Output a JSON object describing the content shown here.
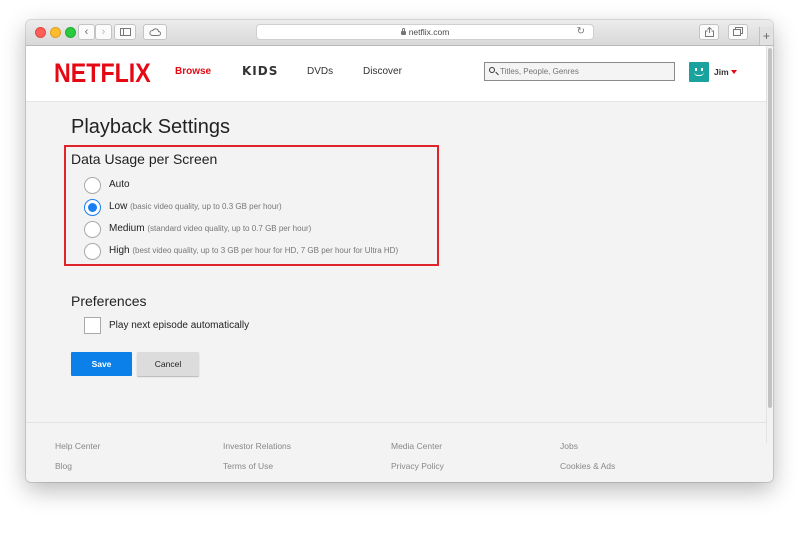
{
  "browser": {
    "url": "netflix.com",
    "reload_icon": "reload-icon",
    "plus_label": "+"
  },
  "header": {
    "logo": "NETFLIX",
    "nav": {
      "browse": "Browse",
      "kids": "KIDS",
      "dvds": "DVDs",
      "discover": "Discover"
    },
    "search_placeholder": "Titles, People, Genres",
    "user_name": "Jim"
  },
  "main": {
    "page_title": "Playback Settings",
    "data_usage": {
      "title": "Data Usage per Screen",
      "options": [
        {
          "label": "Auto",
          "desc": "",
          "selected": false
        },
        {
          "label": "Low",
          "desc": "(basic video quality, up to 0.3 GB per hour)",
          "selected": true
        },
        {
          "label": "Medium",
          "desc": "(standard video quality, up to 0.7 GB per hour)",
          "selected": false
        },
        {
          "label": "High",
          "desc": "(best video quality, up to 3 GB per hour for HD, 7 GB per hour for Ultra HD)",
          "selected": false
        }
      ]
    },
    "preferences": {
      "title": "Preferences",
      "autoplay_label": "Play next episode automatically",
      "autoplay_checked": false
    },
    "buttons": {
      "save": "Save",
      "cancel": "Cancel"
    }
  },
  "footer": {
    "links": [
      [
        "Help Center",
        "Blog"
      ],
      [
        "Investor Relations",
        "Terms of Use"
      ],
      [
        "Media Center",
        "Privacy Policy"
      ],
      [
        "Jobs",
        "Cookies & Ads"
      ]
    ]
  },
  "colors": {
    "brand_red": "#e50914",
    "radio_blue": "#1a7ff0",
    "save_blue": "#0b80e8",
    "highlight_red": "#e0242b",
    "avatar_teal": "#1aa39e"
  }
}
